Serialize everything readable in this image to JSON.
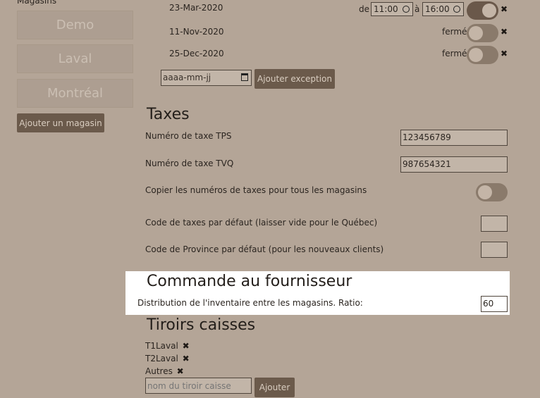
{
  "sidebar": {
    "heading": "Magasins",
    "stores": [
      "Demo",
      "Laval",
      "Montréal"
    ],
    "add_store_label": "Ajouter un magasin"
  },
  "schedule": {
    "rows": [
      {
        "date": "23-Mar-2020",
        "from_label": "de",
        "open": "11:00",
        "to_label": "à",
        "close": "16:00",
        "toggle_on": true
      },
      {
        "date": "11-Nov-2020",
        "status": "fermé",
        "toggle_on": false
      },
      {
        "date": "25-Dec-2020",
        "status": "fermé",
        "toggle_on": false
      }
    ],
    "date_placeholder": "aaaa-mm-jj",
    "add_exception_label": "Ajouter exception",
    "remove_icon": "close-icon"
  },
  "taxes": {
    "title": "Taxes",
    "tps_label": "Numéro de taxe TPS",
    "tps_value": "123456789",
    "tvq_label": "Numéro de taxe TVQ",
    "tvq_value": "987654321",
    "copy_label": "Copier les numéros de taxes pour tous les magasins",
    "copy_on": false,
    "default_code_label": "Code de taxes par défaut (laisser vide pour le Québec)",
    "default_code_value": "",
    "province_label": "Code de Province par défaut (pour les nouveaux clients)",
    "province_value": ""
  },
  "supplier": {
    "title": "Commande au fournisseur",
    "ratio_label": "Distribution de l'inventaire entre les magasins. Ratio:",
    "ratio_value": "60"
  },
  "drawers": {
    "title": "Tiroirs caisses",
    "items": [
      "T1Laval",
      "T2Laval",
      "Autres"
    ],
    "input_placeholder": "nom du tiroir caisse",
    "add_label": "Ajouter"
  },
  "colors": {
    "background": "#b4a597",
    "button": "#6b5a4b",
    "panel_highlight": "#ffffff"
  }
}
